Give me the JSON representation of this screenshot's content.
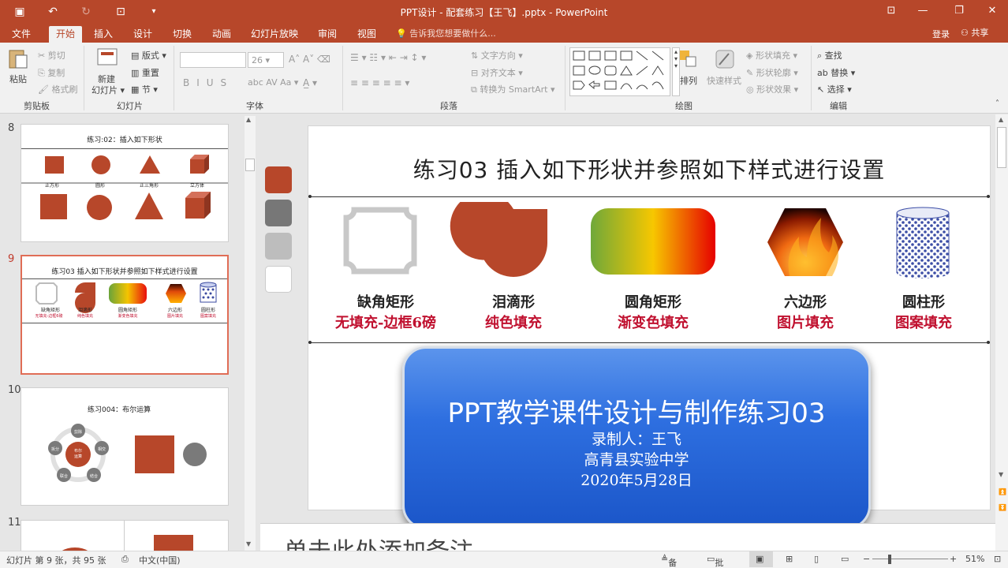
{
  "window": {
    "title": "PPT设计 - 配套练习【王飞】.pptx - PowerPoint"
  },
  "tabs": [
    "文件",
    "开始",
    "插入",
    "设计",
    "切换",
    "动画",
    "幻灯片放映",
    "审阅",
    "视图"
  ],
  "active_tab": "开始",
  "tell_me": "告诉我您想要做什么...",
  "login": "登录",
  "share": "共享",
  "ribbon": {
    "clipboard": {
      "paste": "粘贴",
      "cut": "剪切",
      "copy": "复制",
      "format_painter": "格式刷",
      "group": "剪贴板"
    },
    "slides": {
      "new_slide": "新建",
      "new_slide2": "幻灯片",
      "layout": "版式",
      "reset": "重置",
      "section": "节",
      "group": "幻灯片"
    },
    "font": {
      "font_size": "26",
      "group": "字体"
    },
    "paragraph": {
      "text_direction": "文字方向",
      "align_text": "对齐文本",
      "smartart": "转换为 SmartArt",
      "group": "段落"
    },
    "drawing": {
      "arrange": "排列",
      "quick_styles": "快速样式",
      "shape_fill": "形状填充",
      "shape_outline": "形状轮廓",
      "shape_effects": "形状效果",
      "group": "绘图"
    },
    "editing": {
      "find": "查找",
      "replace": "替换",
      "select": "选择",
      "group": "编辑"
    }
  },
  "thumbnails": [
    {
      "num": "8",
      "title": "练习:02：插入如下形状",
      "labels": [
        "正方形",
        "圆形",
        "正三角形",
        "立方体"
      ]
    },
    {
      "num": "9",
      "title": "练习03   插入如下形状并参照如下样式进行设置",
      "labels": [
        "缺角矩形",
        "泪滴形",
        "圆角矩形",
        "六边形",
        "圆柱形"
      ],
      "sub": [
        "无填充-边框6磅",
        "纯色填充",
        "渐变色填充",
        "图片填充",
        "图案填充"
      ]
    },
    {
      "num": "10",
      "title": "练习004：布尔运算",
      "center": "布尔\n运算",
      "nodes": [
        "剪除",
        "相交",
        "拆分",
        "联合",
        "结合"
      ]
    },
    {
      "num": "11"
    }
  ],
  "slide": {
    "title": "练习03   插入如下形状并参照如下样式进行设置",
    "shapes": [
      {
        "name": "缺角矩形",
        "style": "无填充-边框6磅"
      },
      {
        "name": "泪滴形",
        "style": "纯色填充"
      },
      {
        "name": "圆角矩形",
        "style": "渐变色填充"
      },
      {
        "name": "六边形",
        "style": "图片填充"
      },
      {
        "name": "圆柱形",
        "style": "图案填充"
      }
    ],
    "overlay": {
      "line1": "PPT教学课件设计与制作练习03",
      "line2": "录制人：王飞",
      "line3": "高青县实验中学",
      "line4": "2020年5月28日"
    }
  },
  "notes_placeholder": "单击此处添加备注",
  "colors": {
    "accent": "#b7472a",
    "swatches": [
      "#b7472a",
      "#777777",
      "#bdbdbd",
      "#ffffff"
    ],
    "label_red": "#c0102f"
  },
  "status": {
    "slide_info": "幻灯片 第 9 张，共 95 张",
    "language": "中文(中国)",
    "notes": "备注",
    "comments": "批注",
    "zoom": "51%"
  }
}
